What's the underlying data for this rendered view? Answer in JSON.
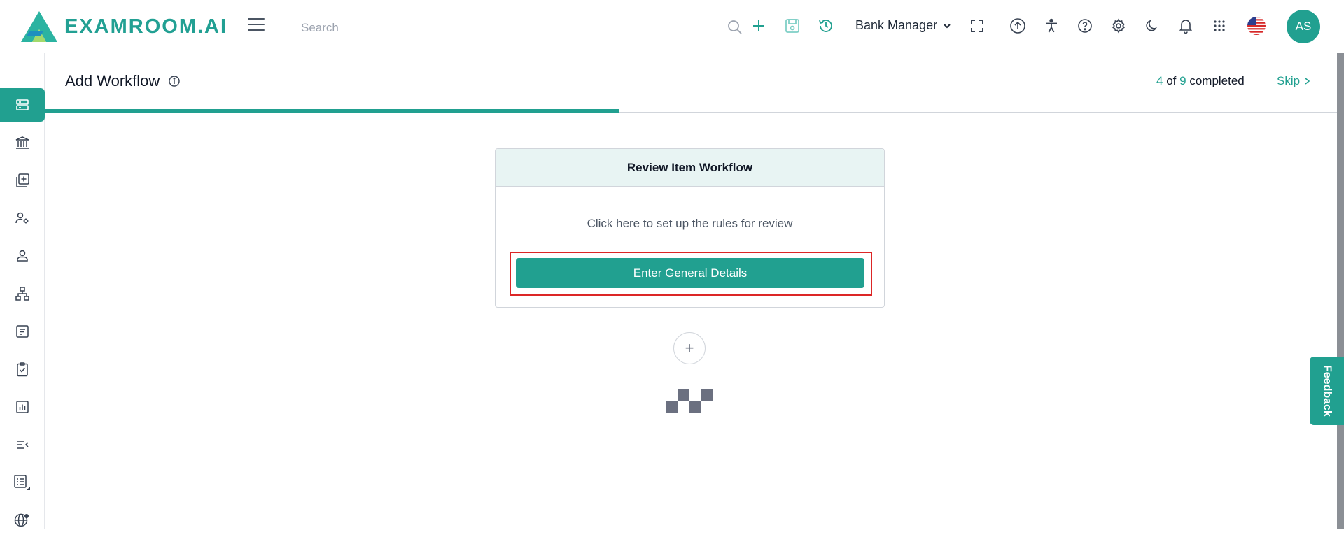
{
  "app": {
    "logo_text": "EXAMROOM.AI",
    "accent": "#21a090"
  },
  "header": {
    "search_placeholder": "Search",
    "role_label": "Bank Manager",
    "avatar_initials": "AS"
  },
  "page": {
    "title": "Add Workflow",
    "progress": {
      "done": "4",
      "of_label": "of",
      "total": "9",
      "completed_label": "completed",
      "fraction": 0.444
    },
    "skip_label": "Skip"
  },
  "workflow": {
    "card_title": "Review Item Workflow",
    "card_subtitle": "Click here to set up the rules for review",
    "button_label": "Enter General Details",
    "add_node_label": "+"
  },
  "feedback_label": "Feedback",
  "sidebar_icons": [
    "server-icon",
    "bank-icon",
    "add-stack-icon",
    "user-settings-icon",
    "user-icon",
    "hierarchy-icon",
    "form-icon",
    "clipboard-check-icon",
    "report-chart-icon",
    "list-collapse-icon",
    "list-table-icon",
    "globe-settings-icon"
  ]
}
